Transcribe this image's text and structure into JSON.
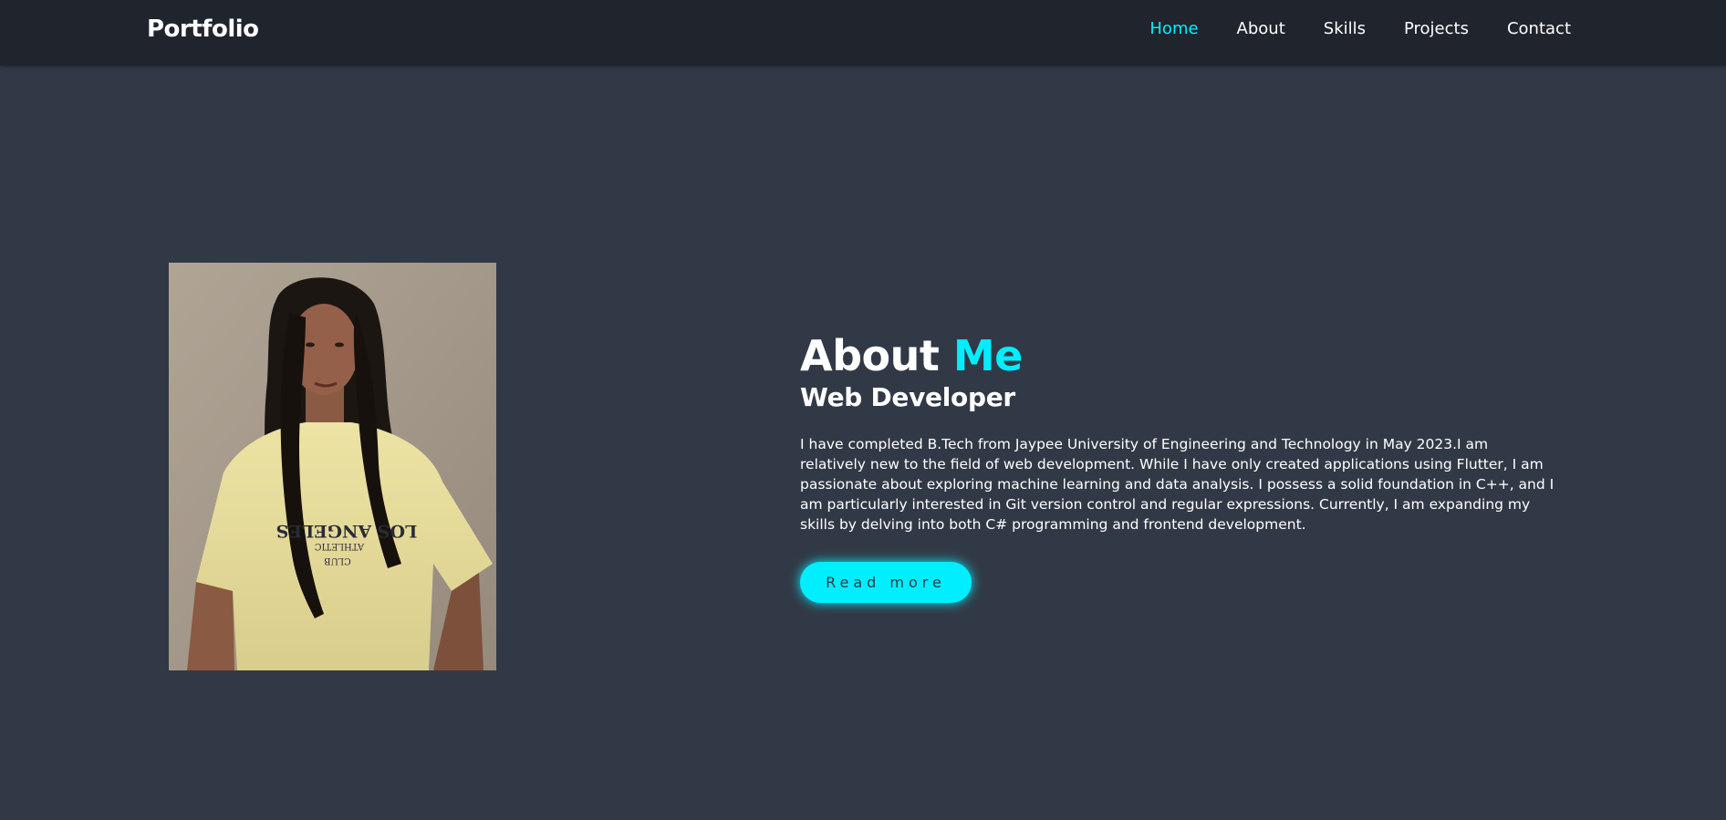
{
  "header": {
    "logo": "Portfolio",
    "nav": [
      {
        "label": "Home",
        "active": true
      },
      {
        "label": "About",
        "active": false
      },
      {
        "label": "Skills",
        "active": false
      },
      {
        "label": "Projects",
        "active": false
      },
      {
        "label": "Contact",
        "active": false
      }
    ]
  },
  "about": {
    "heading_main": "About",
    "heading_accent": "Me",
    "subheading": "Web Developer",
    "paragraph": "I have completed B.Tech from Jaypee University of Engineering and Technology in May 2023.I am relatively new to the field of web development. While I have only created applications using Flutter, I am passionate about exploring machine learning and data analysis. I possess a solid foundation in C++, and I am particularly interested in Git version control and regular expressions. Currently, I am expanding my skills by delving into both C# programming and frontend development.",
    "button_label": "Read more",
    "photo_icon": "profile-photo"
  },
  "colors": {
    "accent": "#00eeff",
    "background": "#323946",
    "header_bg": "#1f242d",
    "text": "#ffffff"
  }
}
